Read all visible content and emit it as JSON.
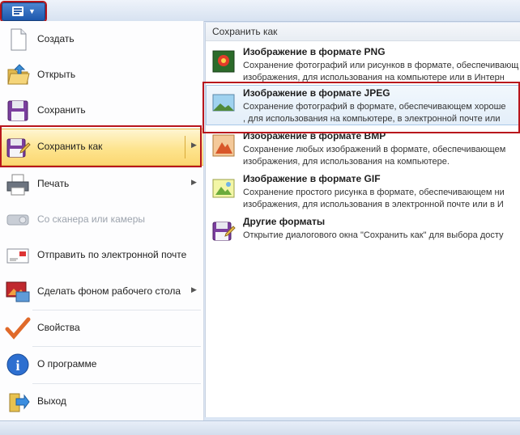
{
  "menu": {
    "items": [
      {
        "label": "Создать",
        "icon": "new-document-icon"
      },
      {
        "label": "Открыть",
        "icon": "open-folder-icon"
      },
      {
        "label": "Сохранить",
        "icon": "save-floppy-icon"
      },
      {
        "label": "Сохранить как",
        "icon": "save-as-icon",
        "highlighted": true,
        "submenu": true
      },
      {
        "label": "Печать",
        "icon": "printer-icon",
        "submenu": true
      },
      {
        "label": "Со сканера или камеры",
        "icon": "scanner-camera-icon",
        "disabled": true
      },
      {
        "label": "Отправить по электронной почте",
        "icon": "email-icon"
      },
      {
        "label": "Сделать фоном рабочего стола",
        "icon": "desktop-background-icon",
        "submenu": true
      },
      {
        "label": "Свойства",
        "icon": "properties-checkmark-icon"
      },
      {
        "label": "О программе",
        "icon": "info-icon"
      },
      {
        "label": "Выход",
        "icon": "exit-icon"
      }
    ]
  },
  "submenu": {
    "header": "Сохранить как",
    "items": [
      {
        "title": "Изображение в формате PNG",
        "desc": "Сохранение фотографий или рисунков в формате, обеспечивающ\nизображения, для использования на компьютере или в Интерн",
        "icon": "png-image-icon"
      },
      {
        "title": "Изображение в формате JPEG",
        "desc": "Сохранение фотографий в формате, обеспечивающем хороше\n, для использования на компьютере, в электронной почте или",
        "icon": "jpeg-image-icon",
        "highlighted": true
      },
      {
        "title": "Изображение в формате BMP",
        "desc": "Сохранение любых изображений в формате, обеспечивающем\nизображения, для использования на компьютере.",
        "icon": "bmp-image-icon"
      },
      {
        "title": "Изображение в формате GIF",
        "desc": "Сохранение простого рисунка в формате, обеспечивающем ни\nизображения, для использования в электронной почте или в И",
        "icon": "gif-image-icon"
      },
      {
        "title": "Другие форматы",
        "desc": "Открытие диалогового окна \"Сохранить как\" для выбора досту",
        "icon": "other-formats-icon"
      }
    ]
  },
  "colors": {
    "highlight_box": "#b8161c",
    "app_button": "#1d58ad",
    "hover_gold": "#fde48e"
  }
}
